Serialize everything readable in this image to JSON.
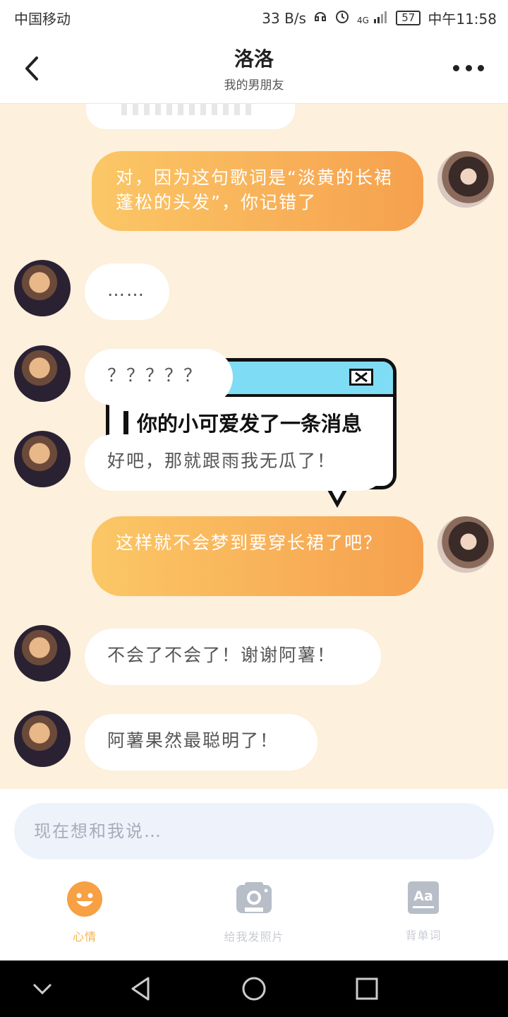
{
  "status_bar": {
    "carrier": "中国移动",
    "speed": "33 B/s",
    "network": "4G",
    "battery": "57",
    "time": "中午11:58"
  },
  "header": {
    "title": "洛洛",
    "subtitle": "我的男朋友",
    "back_icon": "chevron-left-icon",
    "more_icon": "more-dots-icon"
  },
  "messages": [
    {
      "side": "right",
      "text": "对，因为这句歌词是“淡黄的长裙 蓬松的头发”，你记错了"
    },
    {
      "side": "left",
      "text": "……"
    },
    {
      "side": "left",
      "text": "？？？？？"
    },
    {
      "side": "left",
      "text": "好吧，那就跟雨我无瓜了！"
    },
    {
      "side": "right",
      "text": "这样就不会梦到要穿长裙了吧？"
    },
    {
      "side": "left",
      "text": "不会了不会了！谢谢阿薯！"
    },
    {
      "side": "left",
      "text": "阿薯果然最聪明了！"
    }
  ],
  "popup": {
    "title": "你的小可爱发了一条消息"
  },
  "input": {
    "placeholder": "现在想和我说…"
  },
  "tabs": [
    {
      "label": "心情",
      "icon": "smile-icon",
      "active": true
    },
    {
      "label": "给我发照片",
      "icon": "camera-icon",
      "active": false
    },
    {
      "label": "背单词",
      "icon": "dictionary-icon",
      "active": false
    }
  ],
  "colors": {
    "accent": "#f7b24a",
    "bubble_gradient_start": "#fbc766",
    "bubble_gradient_end": "#f6a04e",
    "popup_bar": "#7fdcf5",
    "chat_background": "#fdf0dc"
  }
}
